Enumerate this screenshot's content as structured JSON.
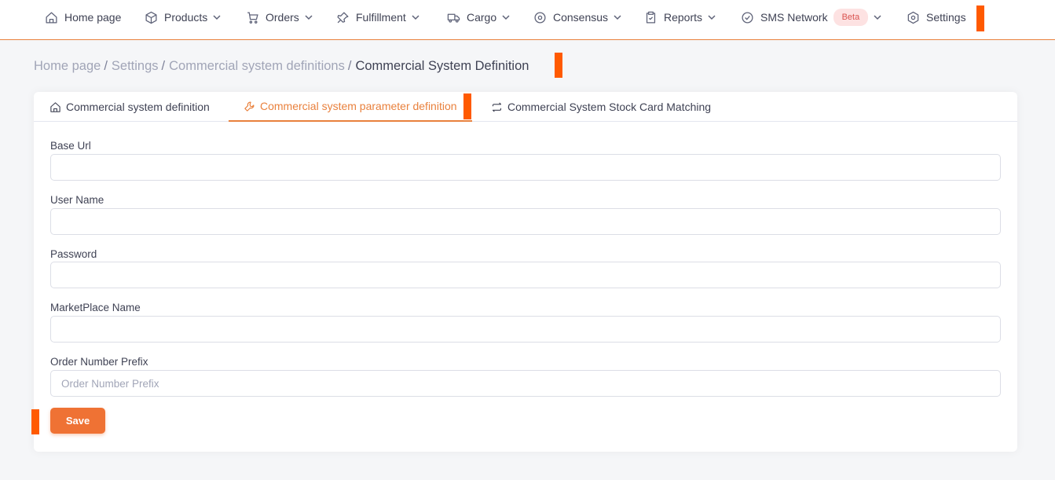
{
  "nav": {
    "home": "Home page",
    "products": "Products",
    "orders": "Orders",
    "fulfillment": "Fulfillment",
    "cargo": "Cargo",
    "consensus": "Consensus",
    "reports": "Reports",
    "sms_network": "SMS Network",
    "sms_badge": "Beta",
    "settings": "Settings"
  },
  "breadcrumb": {
    "items": [
      "Home page",
      "Settings",
      "Commercial system definitions"
    ],
    "separator": "/",
    "current": "Commercial System Definition"
  },
  "tabs": [
    {
      "label": "Commercial system definition",
      "icon": "home-icon"
    },
    {
      "label": "Commercial system parameter definition",
      "icon": "wrench-icon",
      "active": true
    },
    {
      "label": "Commercial System Stock Card Matching",
      "icon": "repeat-icon"
    }
  ],
  "form": {
    "fields": [
      {
        "label": "Base Url",
        "value": "",
        "placeholder": ""
      },
      {
        "label": "User Name",
        "value": "",
        "placeholder": ""
      },
      {
        "label": "Password",
        "value": "",
        "placeholder": ""
      },
      {
        "label": "MarketPlace Name",
        "value": "",
        "placeholder": ""
      },
      {
        "label": "Order Number Prefix",
        "value": "",
        "placeholder": "Order Number Prefix"
      }
    ],
    "save_label": "Save"
  },
  "colors": {
    "accent": "#e9813d",
    "button": "#ef7234",
    "marker": "#ff5a00",
    "badge_bg": "#fde2e2",
    "badge_text": "#d9534f"
  }
}
